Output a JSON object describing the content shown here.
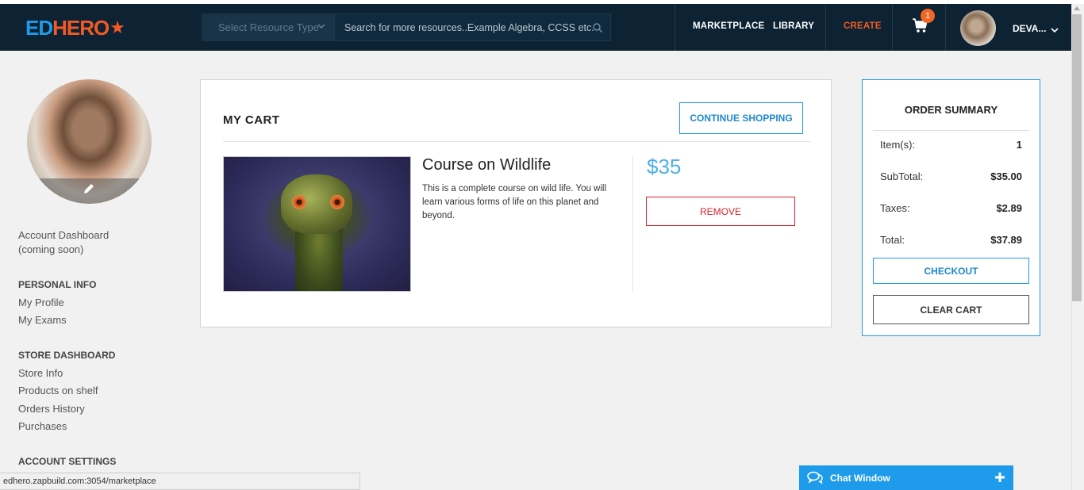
{
  "header": {
    "logo_ed": "ED",
    "logo_hero": "HERO",
    "resource_select": "Select Resource Type",
    "search_placeholder": "Search for more resources..Example Algebra, CCSS etc.",
    "nav": {
      "marketplace": "MARKETPLACE",
      "library": "LIBRARY",
      "create": "CREATE"
    },
    "cart_count": "1",
    "user_name": "DEVA..."
  },
  "sidebar": {
    "account_dashboard": "Account Dashboard",
    "coming_soon": "(coming soon)",
    "personal_info": "PERSONAL INFO",
    "my_profile": "My Profile",
    "my_exams": "My Exams",
    "store_dashboard": "STORE DASHBOARD",
    "store_info": "Store Info",
    "products_on_shelf": "Products on shelf",
    "orders_history": "Orders History",
    "purchases": "Purchases",
    "account_settings": "ACCOUNT SETTINGS"
  },
  "cart": {
    "title": "MY CART",
    "continue_shopping": "CONTINUE SHOPPING",
    "item": {
      "name": "Course on Wildlife",
      "description": "This is a complete course on wild life. You will learn various forms of life on this planet and beyond.",
      "price": "$35",
      "remove": "REMOVE"
    }
  },
  "summary": {
    "title": "ORDER SUMMARY",
    "items_label": "Item(s):",
    "items_value": "1",
    "subtotal_label": "SubTotal:",
    "subtotal_value": "$35.00",
    "taxes_label": "Taxes:",
    "taxes_value": "$2.89",
    "total_label": "Total:",
    "total_value": "$37.89",
    "checkout": "CHECKOUT",
    "clear_cart": "CLEAR CART"
  },
  "status_url": "edhero.zapbuild.com:3054/marketplace",
  "chat": {
    "label": "Chat Window"
  },
  "colors": {
    "header_bg": "#0d2233",
    "accent_blue": "#1e9bea",
    "accent_orange": "#f15a24",
    "remove_red": "#d9232b",
    "price_blue": "#4fb0e6"
  },
  "icons": [
    "star-icon",
    "chevron-down-icon",
    "search-icon",
    "cart-icon",
    "pencil-icon",
    "chat-bubble-icon",
    "plus-icon"
  ]
}
